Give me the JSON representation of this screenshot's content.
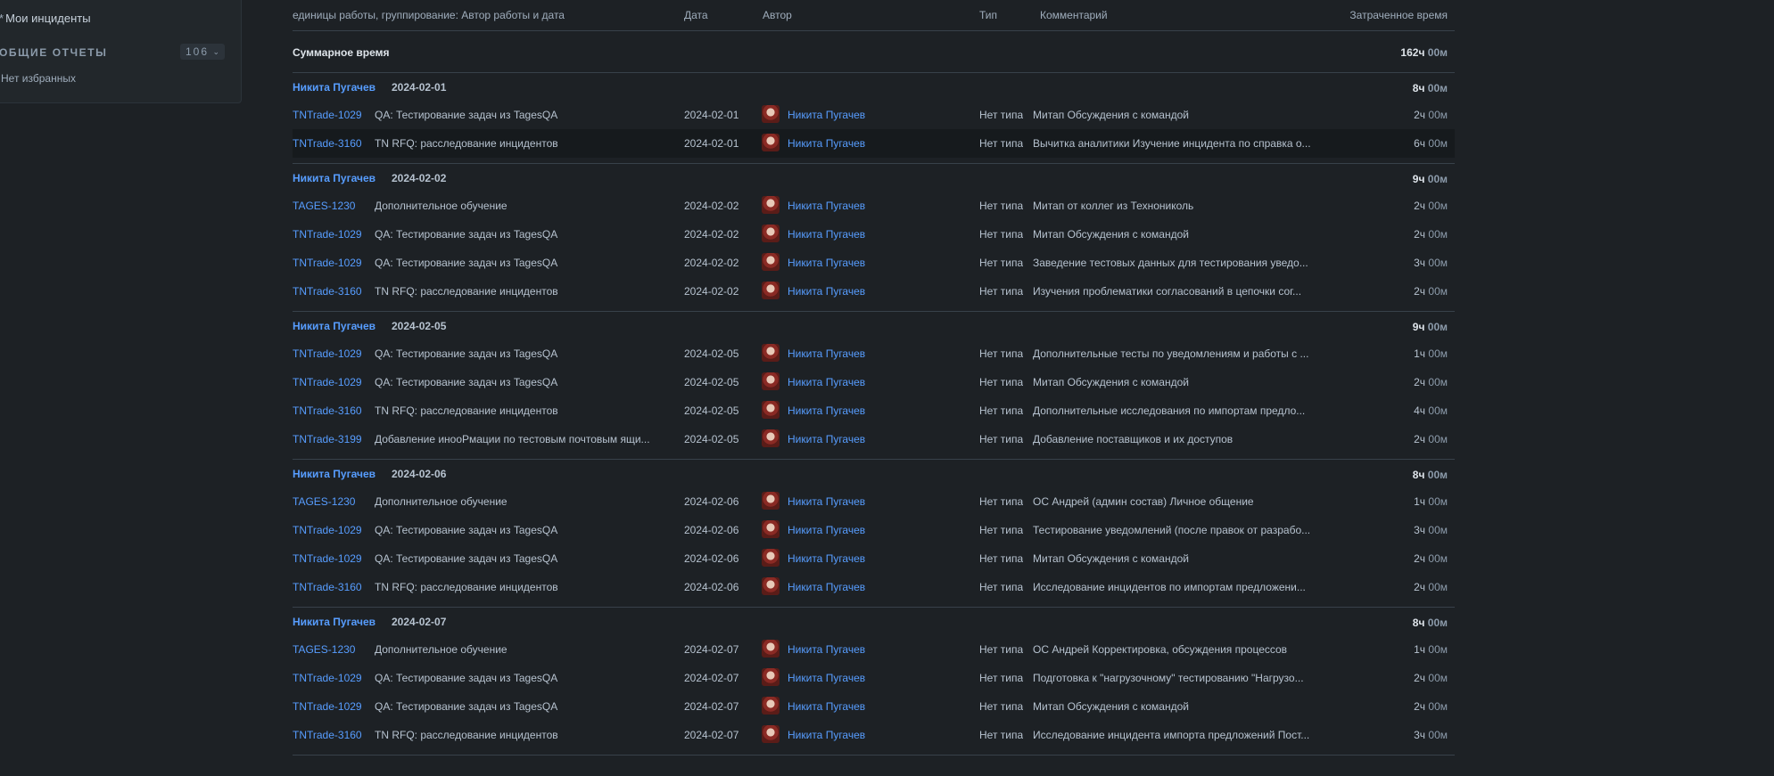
{
  "sidebar": {
    "my_incidents": "Мои инциденты",
    "section_title": "ОБЩИЕ ОТЧЕТЫ",
    "section_count": "106",
    "empty_text": "Нет избранных"
  },
  "header": {
    "units": "единицы работы, группирование: Автор работы и дата",
    "date": "Дата",
    "author": "Автор",
    "type": "Тип",
    "comment": "Комментарий",
    "time_spent": "Затраченное время"
  },
  "total": {
    "label": "Суммарное время",
    "value_h": "162ч",
    "value_m": "00м"
  },
  "groups": [
    {
      "author": "Никита Пугачев",
      "date": "2024-02-01",
      "time_h": "8ч",
      "time_m": "00м",
      "rows": [
        {
          "key": "TNTrade-1029",
          "summary": "QA: Тестирование задач из TagesQA",
          "date": "2024-02-01",
          "author": "Никита Пугачев",
          "type": "Нет типа",
          "comment": "Митап Обсуждения с командой",
          "h": "2ч",
          "m": "00м"
        },
        {
          "key": "TNTrade-3160",
          "summary": "TN RFQ: расследование инцидентов",
          "date": "2024-02-01",
          "author": "Никита Пугачев",
          "type": "Нет типа",
          "comment": "Вычитка аналитики Изучение инцидента по справка о...",
          "h": "6ч",
          "m": "00м",
          "highlight": true
        }
      ]
    },
    {
      "author": "Никита Пугачев",
      "date": "2024-02-02",
      "time_h": "9ч",
      "time_m": "00м",
      "rows": [
        {
          "key": "TAGES-1230",
          "summary": "Дополнительное обучение",
          "date": "2024-02-02",
          "author": "Никита Пугачев",
          "type": "Нет типа",
          "comment": "Митап от коллег из Технониколь",
          "h": "2ч",
          "m": "00м"
        },
        {
          "key": "TNTrade-1029",
          "summary": "QA: Тестирование задач из TagesQA",
          "date": "2024-02-02",
          "author": "Никита Пугачев",
          "type": "Нет типа",
          "comment": "Митап Обсуждения с командой",
          "h": "2ч",
          "m": "00м"
        },
        {
          "key": "TNTrade-1029",
          "summary": "QA: Тестирование задач из TagesQA",
          "date": "2024-02-02",
          "author": "Никита Пугачев",
          "type": "Нет типа",
          "comment": "Заведение тестовых данных для тестирования уведо...",
          "h": "3ч",
          "m": "00м"
        },
        {
          "key": "TNTrade-3160",
          "summary": "TN RFQ: расследование инцидентов",
          "date": "2024-02-02",
          "author": "Никита Пугачев",
          "type": "Нет типа",
          "comment": "Изучения проблематики согласований в цепочки сог...",
          "h": "2ч",
          "m": "00м"
        }
      ]
    },
    {
      "author": "Никита Пугачев",
      "date": "2024-02-05",
      "time_h": "9ч",
      "time_m": "00м",
      "rows": [
        {
          "key": "TNTrade-1029",
          "summary": "QA: Тестирование задач из TagesQA",
          "date": "2024-02-05",
          "author": "Никита Пугачев",
          "type": "Нет типа",
          "comment": "Дополнительные тесты по уведомлениям и работы с ...",
          "h": "1ч",
          "m": "00м"
        },
        {
          "key": "TNTrade-1029",
          "summary": "QA: Тестирование задач из TagesQA",
          "date": "2024-02-05",
          "author": "Никита Пугачев",
          "type": "Нет типа",
          "comment": "Митап Обсуждения с командой",
          "h": "2ч",
          "m": "00м"
        },
        {
          "key": "TNTrade-3160",
          "summary": "TN RFQ: расследование инцидентов",
          "date": "2024-02-05",
          "author": "Никита Пугачев",
          "type": "Нет типа",
          "comment": "Дополнительные исследования по импортам предло...",
          "h": "4ч",
          "m": "00м"
        },
        {
          "key": "TNTrade-3199",
          "summary": "Добавление инооРмации по тестовым почтовым ящи...",
          "date": "2024-02-05",
          "author": "Никита Пугачев",
          "type": "Нет типа",
          "comment": "Добавление поставщиков и их доступов",
          "h": "2ч",
          "m": "00м"
        }
      ]
    },
    {
      "author": "Никита Пугачев",
      "date": "2024-02-06",
      "time_h": "8ч",
      "time_m": "00м",
      "rows": [
        {
          "key": "TAGES-1230",
          "summary": "Дополнительное обучение",
          "date": "2024-02-06",
          "author": "Никита Пугачев",
          "type": "Нет типа",
          "comment": "ОС Андрей (админ состав) Личное общение",
          "h": "1ч",
          "m": "00м"
        },
        {
          "key": "TNTrade-1029",
          "summary": "QA: Тестирование задач из TagesQA",
          "date": "2024-02-06",
          "author": "Никита Пугачев",
          "type": "Нет типа",
          "comment": "Тестирование уведомлений (после правок от разрабо...",
          "h": "3ч",
          "m": "00м"
        },
        {
          "key": "TNTrade-1029",
          "summary": "QA: Тестирование задач из TagesQA",
          "date": "2024-02-06",
          "author": "Никита Пугачев",
          "type": "Нет типа",
          "comment": "Митап Обсуждения с командой",
          "h": "2ч",
          "m": "00м"
        },
        {
          "key": "TNTrade-3160",
          "summary": "TN RFQ: расследование инцидентов",
          "date": "2024-02-06",
          "author": "Никита Пугачев",
          "type": "Нет типа",
          "comment": "Исследование инцидентов по импортам предложени...",
          "h": "2ч",
          "m": "00м"
        }
      ]
    },
    {
      "author": "Никита Пугачев",
      "date": "2024-02-07",
      "time_h": "8ч",
      "time_m": "00м",
      "rows": [
        {
          "key": "TAGES-1230",
          "summary": "Дополнительное обучение",
          "date": "2024-02-07",
          "author": "Никита Пугачев",
          "type": "Нет типа",
          "comment": "ОС Андрей Корректировка, обсуждения процессов",
          "h": "1ч",
          "m": "00м"
        },
        {
          "key": "TNTrade-1029",
          "summary": "QA: Тестирование задач из TagesQA",
          "date": "2024-02-07",
          "author": "Никита Пугачев",
          "type": "Нет типа",
          "comment": "Подготовка к \"нагрузочному\" тестированию \"Нагрузо...",
          "h": "2ч",
          "m": "00м"
        },
        {
          "key": "TNTrade-1029",
          "summary": "QA: Тестирование задач из TagesQA",
          "date": "2024-02-07",
          "author": "Никита Пугачев",
          "type": "Нет типа",
          "comment": "Митап Обсуждения с командой",
          "h": "2ч",
          "m": "00м"
        },
        {
          "key": "TNTrade-3160",
          "summary": "TN RFQ: расследование инцидентов",
          "date": "2024-02-07",
          "author": "Никита Пугачев",
          "type": "Нет типа",
          "comment": "Исследование инцидента импорта предложений Пост...",
          "h": "3ч",
          "m": "00м"
        }
      ]
    }
  ]
}
